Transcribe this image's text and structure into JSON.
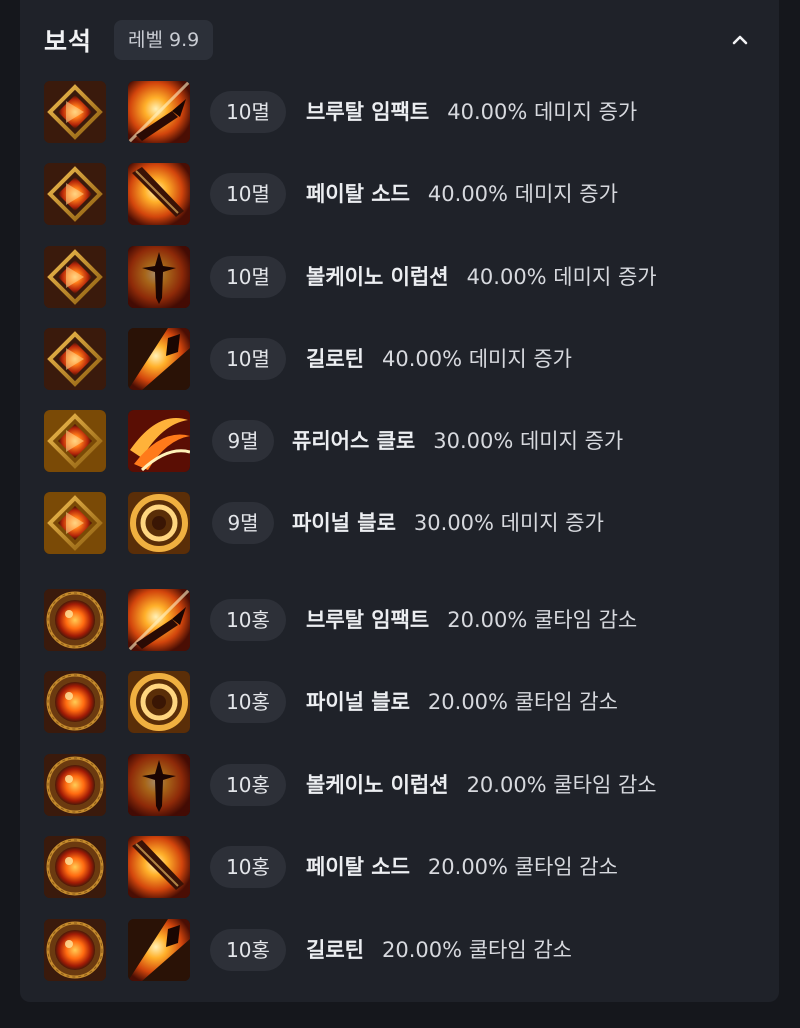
{
  "section": {
    "title": "보석",
    "level_label": "레벨 9.9"
  },
  "gems": [
    {
      "gem": "10멸",
      "gem_type": "damage",
      "skill": "브루탈 임팩트",
      "effect": "40.00% 데미지 증가",
      "skill_icon": "brutal-impact-icon"
    },
    {
      "gem": "10멸",
      "gem_type": "damage",
      "skill": "페이탈 소드",
      "effect": "40.00% 데미지 증가",
      "skill_icon": "fatal-sword-icon"
    },
    {
      "gem": "10멸",
      "gem_type": "damage",
      "skill": "볼케이노 이럽션",
      "effect": "40.00% 데미지 증가",
      "skill_icon": "volcano-eruption-icon"
    },
    {
      "gem": "10멸",
      "gem_type": "damage",
      "skill": "길로틴",
      "effect": "40.00% 데미지 증가",
      "skill_icon": "guillotine-icon"
    },
    {
      "gem": "9멸",
      "gem_type": "damage",
      "skill": "퓨리어스 클로",
      "effect": "30.00% 데미지 증가",
      "skill_icon": "furious-claw-icon"
    },
    {
      "gem": "9멸",
      "gem_type": "damage",
      "skill": "파이널 블로",
      "effect": "30.00% 데미지 증가",
      "skill_icon": "final-blow-icon"
    },
    {
      "gem": "10홍",
      "gem_type": "cooldown",
      "skill": "브루탈 임팩트",
      "effect": "20.00% 쿨타임 감소",
      "skill_icon": "brutal-impact-icon"
    },
    {
      "gem": "10홍",
      "gem_type": "cooldown",
      "skill": "파이널 블로",
      "effect": "20.00% 쿨타임 감소",
      "skill_icon": "final-blow-icon"
    },
    {
      "gem": "10홍",
      "gem_type": "cooldown",
      "skill": "볼케이노 이럽션",
      "effect": "20.00% 쿨타임 감소",
      "skill_icon": "volcano-eruption-icon"
    },
    {
      "gem": "10홍",
      "gem_type": "cooldown",
      "skill": "페이탈 소드",
      "effect": "20.00% 쿨타임 감소",
      "skill_icon": "fatal-sword-icon"
    },
    {
      "gem": "10홍",
      "gem_type": "cooldown",
      "skill": "길로틴",
      "effect": "20.00% 쿨타임 감소",
      "skill_icon": "guillotine-icon"
    }
  ],
  "colors": {
    "background": "#15171c",
    "panel": "#1f2229",
    "pill": "#2d3038",
    "text": "#d7d9de"
  }
}
